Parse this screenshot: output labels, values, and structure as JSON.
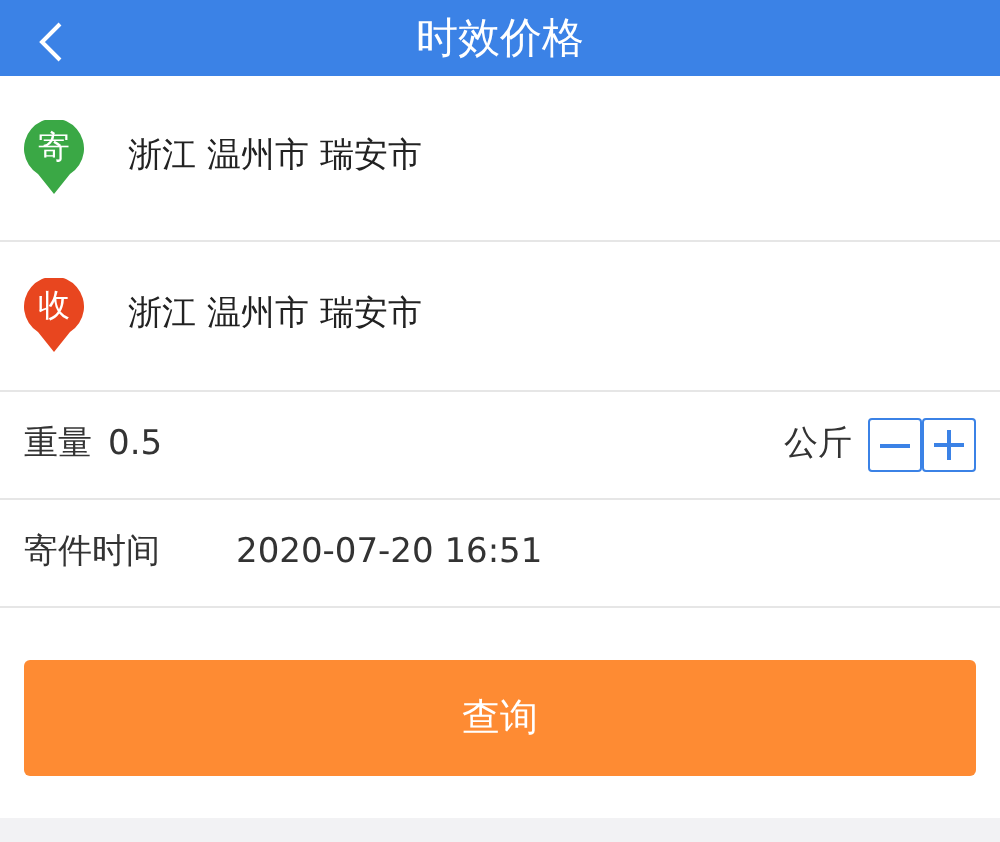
{
  "header": {
    "title": "时效价格"
  },
  "addresses": [
    {
      "pin": "寄",
      "color": "#3aa845",
      "text": "浙江 温州市 瑞安市"
    },
    {
      "pin": "收",
      "color": "#e8461f",
      "text": "浙江 温州市 瑞安市"
    }
  ],
  "weight": {
    "label": "重量",
    "value": "0.5",
    "unit": "公斤"
  },
  "send_time": {
    "label": "寄件时间",
    "value": "2020-07-20 16:51"
  },
  "query_button": "查询"
}
